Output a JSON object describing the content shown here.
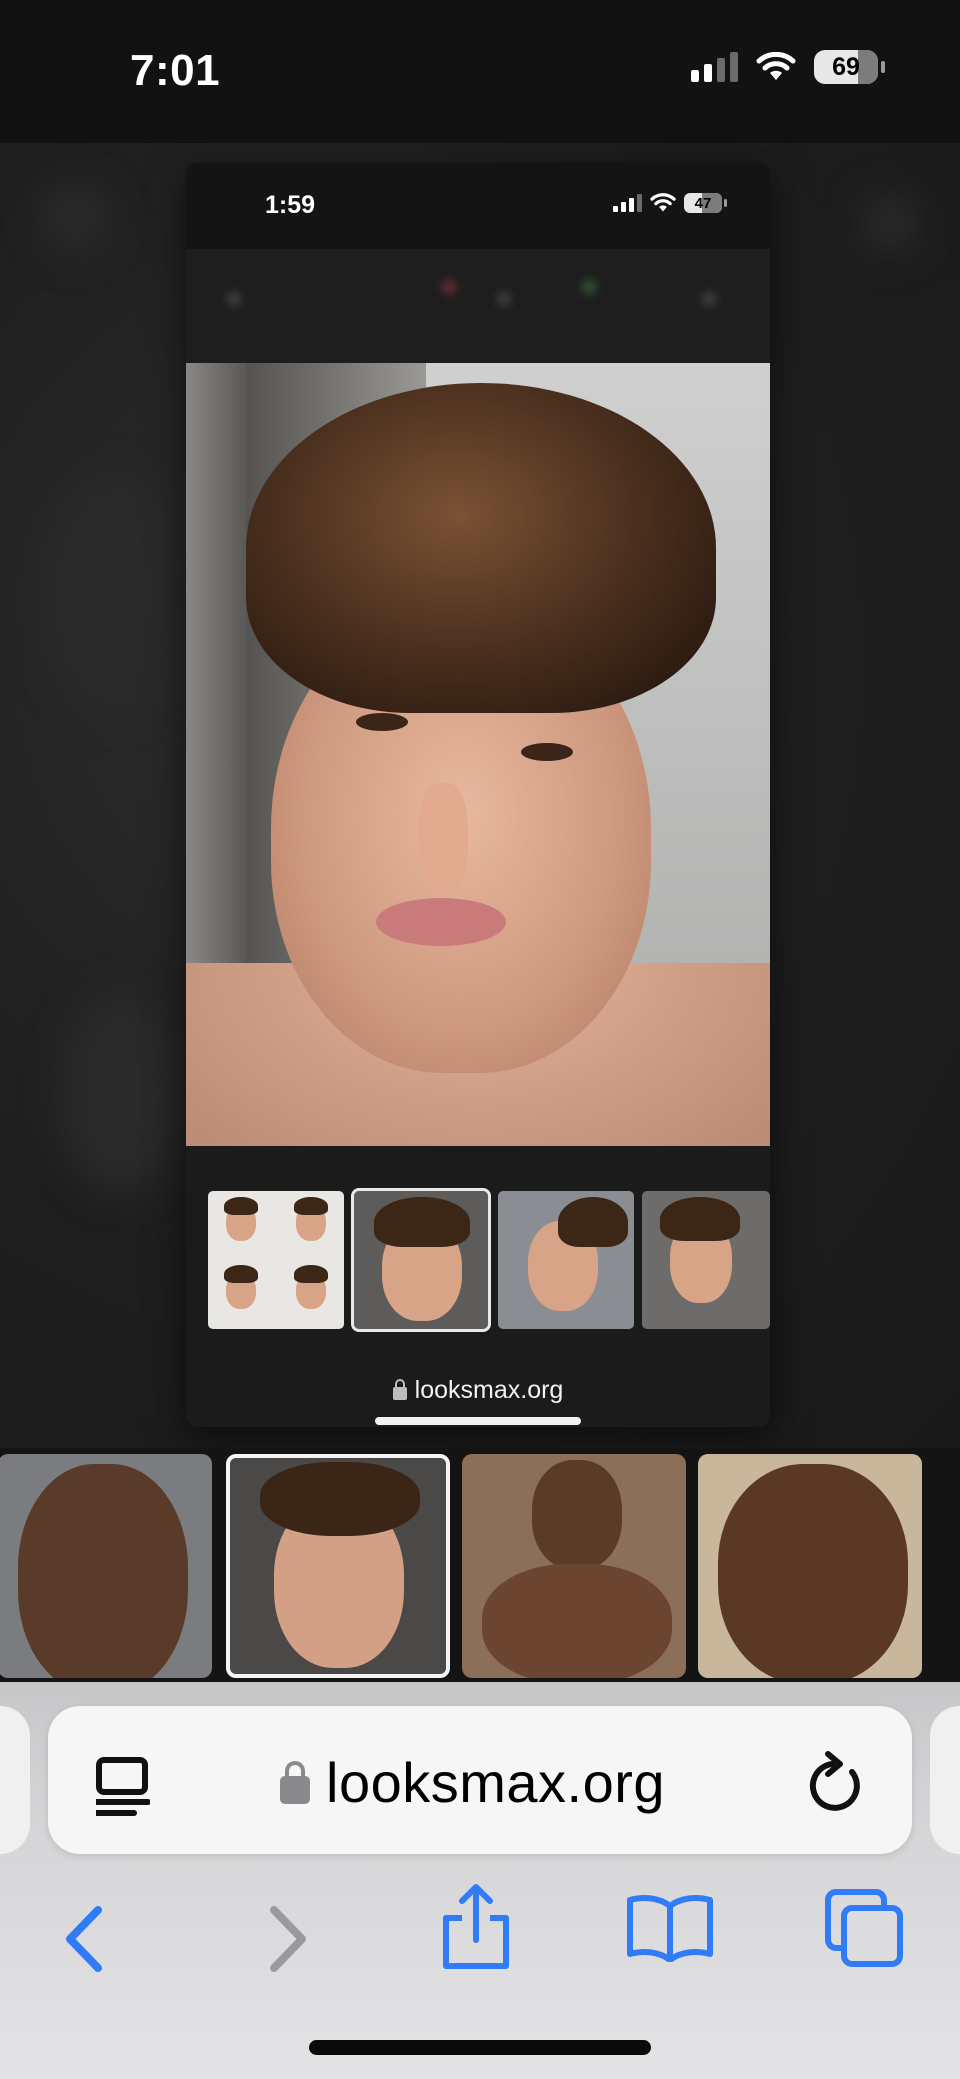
{
  "status_bar": {
    "time": "7:01",
    "battery": "69"
  },
  "tab_card": {
    "status_time": "1:59",
    "status_battery": "47",
    "url": "looksmax.org"
  },
  "address_bar": {
    "url": "looksmax.org"
  },
  "toolbar": {
    "back_icon": "chevron-left-icon",
    "forward_icon": "chevron-right-icon",
    "share_icon": "share-icon",
    "bookmarks_icon": "book-icon",
    "tabs_icon": "tabs-icon"
  },
  "colors": {
    "accent": "#2f7cf6",
    "disabled": "#9a9a9e"
  }
}
